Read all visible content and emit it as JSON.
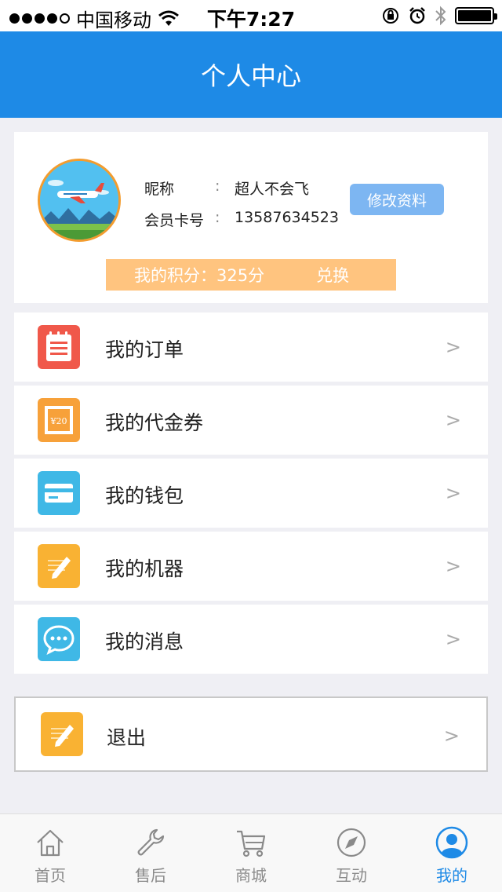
{
  "status_bar": {
    "carrier": "中国移动",
    "time": "下午7:27"
  },
  "header": {
    "title": "个人中心"
  },
  "profile": {
    "nickname_label": "昵称",
    "nickname_value": "超人不会飞",
    "card_label": "会员卡号",
    "card_value": "13587634523",
    "separator": ":",
    "edit_label": "修改资料",
    "points_label": "我的积分：325分",
    "exchange_label": "兑换"
  },
  "menu": {
    "items": [
      {
        "label": "我的订单",
        "icon": "order-icon",
        "color": "#f0584a"
      },
      {
        "label": "我的代金券",
        "icon": "voucher-icon",
        "color": "#f7a13a"
      },
      {
        "label": "我的钱包",
        "icon": "wallet-icon",
        "color": "#3fb8e6"
      },
      {
        "label": "我的机器",
        "icon": "machine-icon",
        "color": "#f9b233"
      },
      {
        "label": "我的消息",
        "icon": "message-icon",
        "color": "#3fb8e6"
      }
    ],
    "arrow": ">",
    "logout_label": "退出"
  },
  "tabbar": {
    "tabs": [
      {
        "label": "首页",
        "icon": "home-icon"
      },
      {
        "label": "售后",
        "icon": "wrench-icon"
      },
      {
        "label": "商城",
        "icon": "cart-icon"
      },
      {
        "label": "互动",
        "icon": "compass-icon"
      },
      {
        "label": "我的",
        "icon": "user-icon",
        "active": true
      }
    ]
  },
  "colors": {
    "brand": "#1e8ae6",
    "points_bg": "#ffc47f",
    "edit_btn": "#7db6f2"
  }
}
